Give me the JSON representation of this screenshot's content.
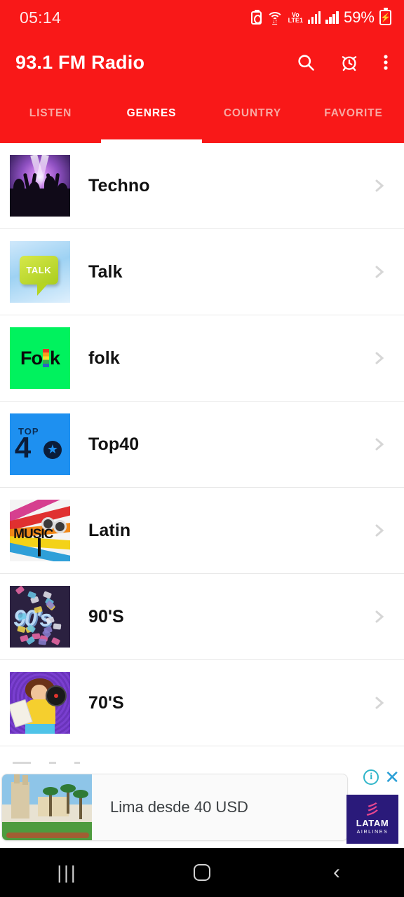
{
  "status_bar": {
    "time": "05:14",
    "battery_percent": "59%",
    "network_label": "Vo\nLTE1",
    "network_line1": "Vo",
    "network_line2": "LTE1",
    "icons": [
      "battery-saver-icon",
      "wifi-icon",
      "volte-icon",
      "signal-bars-icon",
      "signal-bars-icon",
      "battery-charging-icon"
    ]
  },
  "app_bar": {
    "title": "93.1 FM Radio",
    "actions": [
      {
        "name": "search-icon",
        "label": "Search"
      },
      {
        "name": "alarm-icon",
        "label": "Sleep timer"
      },
      {
        "name": "overflow-menu-icon",
        "label": "More options"
      }
    ]
  },
  "tabs": {
    "active_index": 1,
    "items": [
      {
        "label": "LISTEN"
      },
      {
        "label": "GENRES"
      },
      {
        "label": "COUNTRY"
      },
      {
        "label": "FAVORITE"
      }
    ]
  },
  "genre_list": [
    {
      "label": "Techno",
      "art": "techno"
    },
    {
      "label": "Talk",
      "art": "talk",
      "art_text": "TALK"
    },
    {
      "label": "folk",
      "art": "folk",
      "art_text": "Fo|k"
    },
    {
      "label": "Top40",
      "art": "top40",
      "art_text_top": "TOP",
      "art_text_num": "4"
    },
    {
      "label": "Latin",
      "art": "latin",
      "art_text": "MUSIC"
    },
    {
      "label": "90'S",
      "art": "nineties",
      "art_text": "90's"
    },
    {
      "label": "70'S",
      "art": "seventies"
    }
  ],
  "ad": {
    "headline": "Lima desde 40 USD",
    "brand_name": "LATAM",
    "brand_sub": "AIRLINES",
    "brand_color": "#2a1a7a",
    "info_label": "i",
    "close_label": "✕"
  },
  "nav_bar": {
    "recents_label": "|||",
    "home_label": "",
    "back_label": "‹"
  },
  "colors": {
    "primary": "#f91818",
    "tab_inactive": "#f8a9a3",
    "divider": "#e8e8e8",
    "chevron": "#d6d6d6"
  }
}
